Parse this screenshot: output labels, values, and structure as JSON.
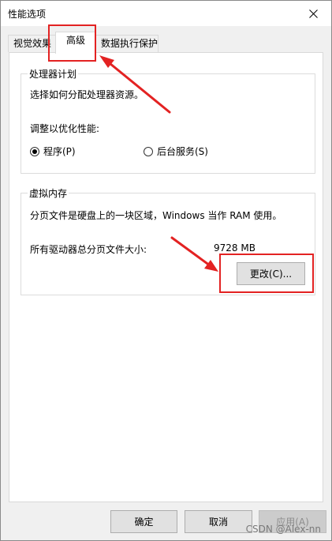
{
  "window": {
    "title": "性能选项"
  },
  "tabs": [
    {
      "label": "视觉效果",
      "active": false
    },
    {
      "label": "高级",
      "active": true
    },
    {
      "label": "数据执行保护",
      "active": false
    }
  ],
  "processor_group": {
    "title": "处理器计划",
    "description": "选择如何分配处理器资源。",
    "adjust_label": "调整以优化性能:",
    "option_programs": "程序(P)",
    "option_services": "后台服务(S)",
    "selected": "programs"
  },
  "virtual_memory_group": {
    "title": "虚拟内存",
    "description": "分页文件是硬盘上的一块区域，Windows 当作 RAM 使用。",
    "total_label": "所有驱动器总分页文件大小:",
    "total_value": "9728 MB",
    "change_button": "更改(C)..."
  },
  "footer": {
    "ok": "确定",
    "cancel": "取消",
    "apply": "应用(A)"
  },
  "watermark": "CSDN @Alex-nn",
  "annotation_color": "#e32222"
}
